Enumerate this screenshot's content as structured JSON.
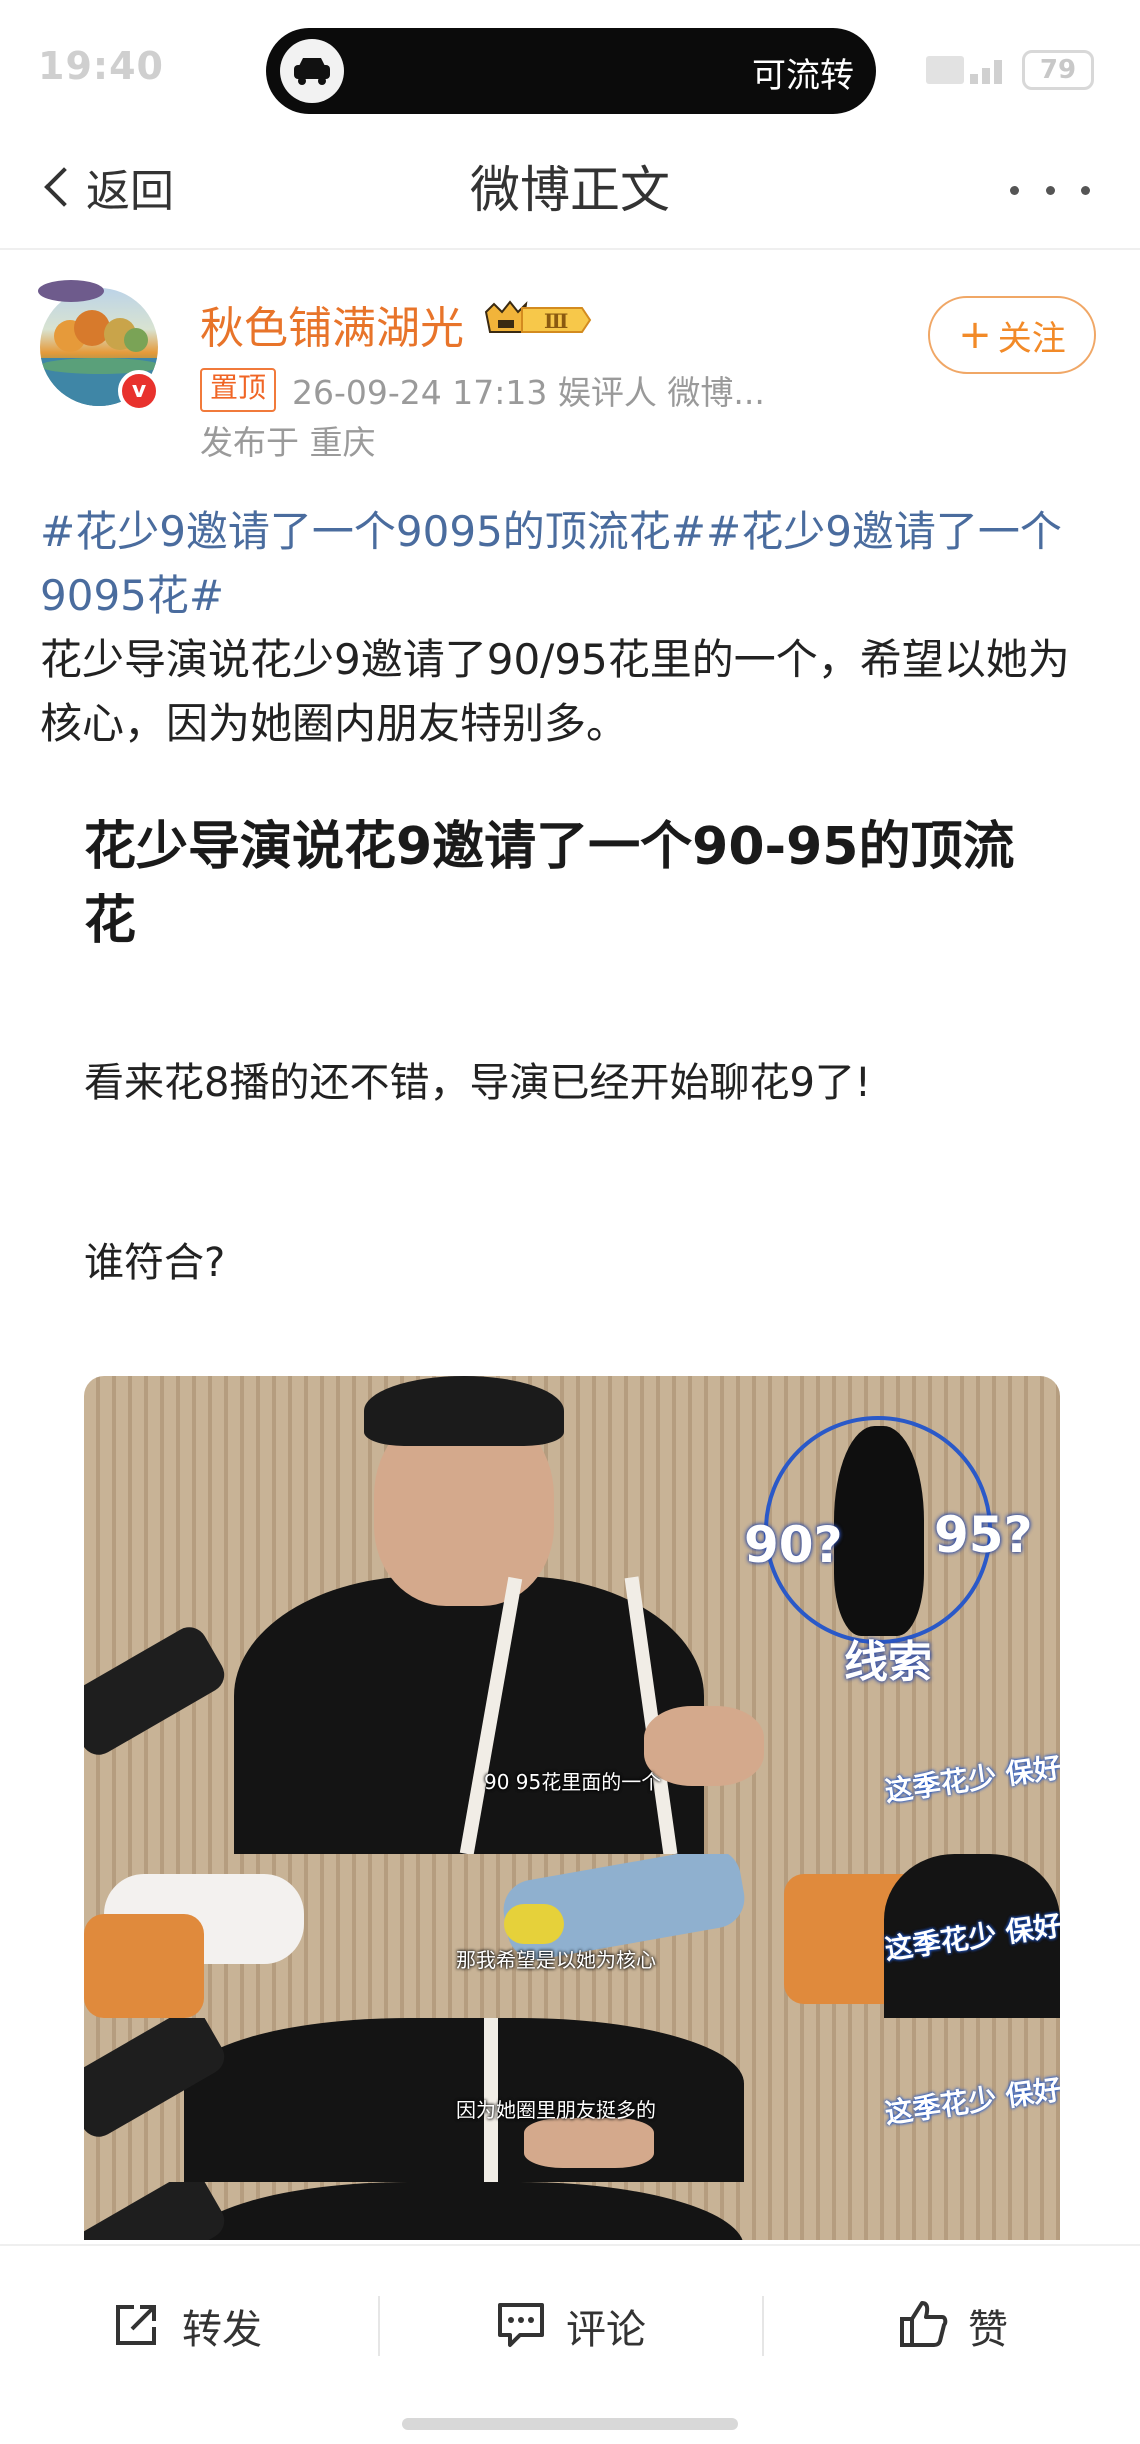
{
  "status_bar": {
    "time": "19:40",
    "island_text": "可流转",
    "battery": "79",
    "island_icon": "car-icon"
  },
  "nav": {
    "back_label": "返回",
    "title": "微博正文",
    "more_icon": "more-dots-icon"
  },
  "author": {
    "name": "秋色铺满湖光",
    "vip_level": "Ⅲ",
    "follow_label": "关注",
    "pin_label": "置顶",
    "meta": "26-09-24 17:13  娱评人   微博...",
    "location": "发布于 重庆",
    "name_color": "#e8742a"
  },
  "post": {
    "hashtag1": "#花少9邀请了一个9095的顶流花#",
    "hashtag2": "#花少9邀请了一个9095花#",
    "body": "花少导演说花少9邀请了90/95花里的一个，希望以她为核心，因为她圈内朋友特别多。",
    "hashtag_color": "#4a6c9e"
  },
  "article": {
    "title": "花少导演说花9邀请了一个90-95的顶流花",
    "line1": "看来花8播的还不错，导演已经开始聊花9了!",
    "line2": "谁符合?",
    "frames": {
      "q90": "90?",
      "q95": "95?",
      "clue": "线索",
      "caption1": "90 95花里面的一个",
      "caption2": "那我希望是以她为核心",
      "caption3": "因为她圈里朋友挺多的",
      "show_logo": "这季花少 保好看"
    }
  },
  "bottom_bar": {
    "repost_label": "转发",
    "comment_label": "评论",
    "like_label": "赞"
  }
}
